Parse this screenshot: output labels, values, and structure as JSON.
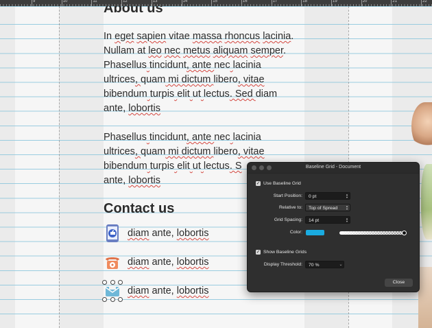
{
  "ruler": {
    "ticks": [
      "9",
      "10",
      "11",
      "12",
      "13",
      "14",
      "15",
      "16",
      "17",
      "18",
      "19",
      "20",
      "21",
      "22"
    ]
  },
  "article": {
    "about_heading": "About us",
    "para1": [
      [
        "In ",
        "eget",
        " ",
        "sapien",
        " vitae ",
        "massa",
        " ",
        "rhoncus",
        " ",
        "lacinia",
        "."
      ],
      [
        "Nullam at ",
        "leo",
        " ",
        "nec",
        " ",
        "metus",
        " ",
        "aliquam",
        " ",
        "semper",
        "."
      ],
      [
        "Phasellus",
        " ",
        "tincidunt",
        ", ante ",
        "nec",
        " ",
        "lacinia",
        ""
      ],
      [
        "ultrices",
        ", ",
        "quam",
        " mi dictum ",
        "libero",
        ", vitae",
        ""
      ],
      [
        "bibendum",
        " ",
        "turpis",
        " ",
        "elit",
        " ",
        "ut",
        " ",
        "lectus",
        ". Sed ",
        "diam"
      ],
      [
        "ante, ",
        "lobortis",
        ""
      ]
    ],
    "para2": [
      [
        "Phasellus",
        " ",
        "tincidunt",
        ", ante ",
        "nec",
        " ",
        "lacinia",
        ""
      ],
      [
        "ultrices",
        ", ",
        "quam",
        " mi dictum ",
        "libero",
        ", vitae",
        ""
      ],
      [
        "bibendum",
        " ",
        "turpis",
        " ",
        "elit",
        " ",
        "ut",
        " ",
        "lectus",
        ". S",
        ""
      ],
      [
        "ante, ",
        "lobortis",
        ""
      ]
    ],
    "contact_heading": "Contact us",
    "contacts": [
      {
        "icon": "phone-like-icon",
        "pre": "",
        "w1": "diam",
        "mid": " ante, ",
        "w2": "lobortis"
      },
      {
        "icon": "telephone-icon",
        "pre": "",
        "w1": "diam",
        "mid": " ante, ",
        "w2": "lobortis"
      },
      {
        "icon": "envelope-icon",
        "pre": "",
        "w1": "diam",
        "mid": " ante, ",
        "w2": "lobortis"
      }
    ]
  },
  "panel": {
    "title": "Baseline Grid - Document",
    "use_baseline_grid": "Use Baseline Grid",
    "start_position_label": "Start Position:",
    "start_position_value": "0 pt",
    "relative_to_label": "Relative to:",
    "relative_to_value": "Top of Spread",
    "grid_spacing_label": "Grid Spacing:",
    "grid_spacing_value": "14 pt",
    "color_label": "Color:",
    "grid_color": "#1aabe0",
    "show_baseline_grids": "Show Baseline Grids",
    "display_threshold_label": "Display Threshold:",
    "display_threshold_value": "70 %",
    "close_label": "Close"
  }
}
